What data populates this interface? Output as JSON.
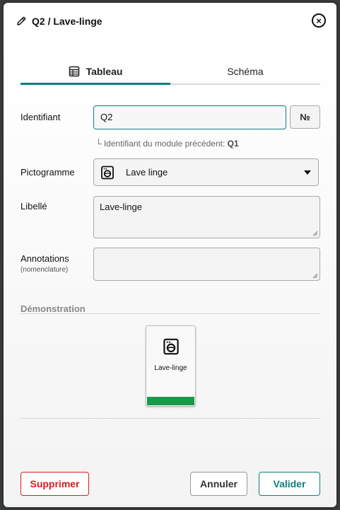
{
  "header": {
    "title": "Q2  / Lave-linge",
    "edit_icon": "pencil-icon",
    "close_icon": "close-circle-icon"
  },
  "tabs": [
    {
      "label": "Tableau",
      "icon": "table-icon",
      "active": true
    },
    {
      "label": "Schéma",
      "active": false
    }
  ],
  "form": {
    "identifiant_label": "Identifiant",
    "identifiant_value": "Q2",
    "number_button_label": "№",
    "hint_text": "└ Identifiant du module précédent: ",
    "hint_value": "Q1",
    "pictogramme_label": "Pictogramme",
    "pictogramme_value": "Lave linge",
    "pictogramme_icon": "washing-machine-icon",
    "libelle_label": "Libellé",
    "libelle_value": "Lave-linge",
    "annotations_label": "Annotations",
    "annotations_sublabel": "(nomenclature)",
    "annotations_value": ""
  },
  "demo": {
    "section_title": "Démonstration",
    "card_label": "Lave-linge",
    "card_icon": "washing-machine-icon",
    "bar_color": "#1a9a47"
  },
  "footer": {
    "delete_label": "Supprimer",
    "cancel_label": "Annuler",
    "validate_label": "Valider"
  },
  "colors": {
    "accent": "#0b7f80",
    "danger": "#d91c1c"
  }
}
